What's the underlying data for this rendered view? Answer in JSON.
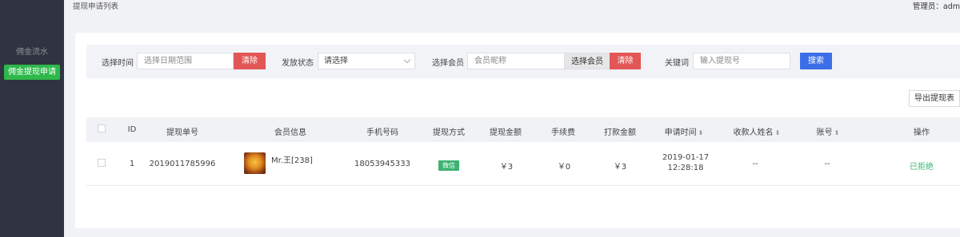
{
  "sidebar": {
    "items": [
      {
        "label": "佣金流水"
      },
      {
        "label": "佣金提现申请"
      }
    ]
  },
  "header": {
    "title": "提现申请列表",
    "admin_label": "管理员：adm"
  },
  "filters": {
    "time_label": "选择时间",
    "time_placeholder": "选择日期范围",
    "clear_label": "清除",
    "status_label": "发放状态",
    "status_value": "请选择",
    "member_label": "选择会员",
    "member_placeholder": "会员昵称",
    "member_button": "选择会员",
    "member_clear": "清除",
    "keyword_label": "关键词",
    "keyword_placeholder": "输入提现号",
    "search_button": "搜索"
  },
  "export_button": "导出提现表",
  "table": {
    "headers": {
      "id": "ID",
      "order_no": "提现单号",
      "member": "会员信息",
      "phone": "手机号码",
      "method": "提现方式",
      "amount": "提现金额",
      "fee": "手续费",
      "paid": "打款金额",
      "apply_time": "申请时间",
      "payee": "收款人姓名",
      "account": "账号",
      "action": "操作"
    },
    "rows": [
      {
        "id": "1",
        "order_no": "2019011785996",
        "member": "Mr.王[238]",
        "phone": "18053945333",
        "method": "微信",
        "amount": "￥3",
        "fee": "￥0",
        "paid": "￥3",
        "apply_date": "2019-01-17",
        "apply_clock": "12:28:18",
        "payee": "--",
        "account": "--",
        "action": "已拒绝"
      }
    ]
  },
  "colors": {
    "sidebar_bg": "#2f3440",
    "active_green": "#2eb84b",
    "danger_red": "#e35656",
    "primary_blue": "#3d6ee8",
    "status_green": "#3cb371"
  }
}
